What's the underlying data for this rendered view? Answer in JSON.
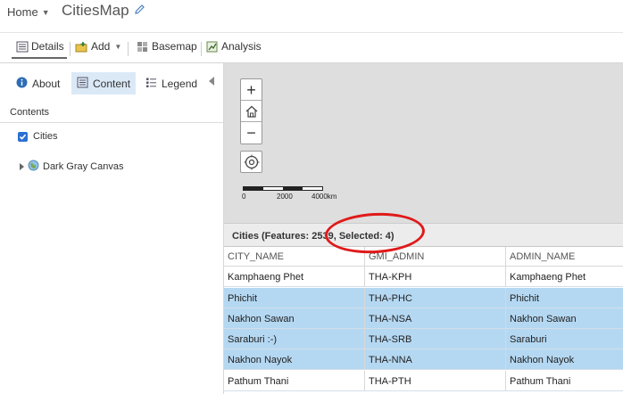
{
  "header": {
    "home_label": "Home",
    "app_title": "CitiesMap"
  },
  "toolbar": {
    "details_label": "Details",
    "add_label": "Add",
    "basemap_label": "Basemap",
    "analysis_label": "Analysis"
  },
  "panel": {
    "tabs": [
      {
        "label": "About"
      },
      {
        "label": "Content",
        "active": true
      },
      {
        "label": "Legend"
      }
    ],
    "section_title": "Contents",
    "layers": [
      {
        "label": "Cities",
        "checked": true
      }
    ],
    "basemap_layer": "Dark Gray Canvas"
  },
  "map": {
    "zoom_in": "+",
    "zoom_out": "−",
    "scale_labels": [
      "0",
      "2000",
      "4000km"
    ]
  },
  "table": {
    "caption": "Cities (Features: 2539, Selected: 4)",
    "columns": [
      "CITY_NAME",
      "GMI_ADMIN",
      "ADMIN_NAME"
    ],
    "rows": [
      {
        "city": "Kamphaeng Phet",
        "gmi": "THA-KPH",
        "admin": "Kamphaeng Phet",
        "selected": false
      },
      {
        "city": "Phichit",
        "gmi": "THA-PHC",
        "admin": "Phichit",
        "selected": true
      },
      {
        "city": "Nakhon Sawan",
        "gmi": "THA-NSA",
        "admin": "Nakhon Sawan",
        "selected": true
      },
      {
        "city": "Saraburi :-)",
        "gmi": "THA-SRB",
        "admin": "Saraburi",
        "selected": true
      },
      {
        "city": "Nakhon Nayok",
        "gmi": "THA-NNA",
        "admin": "Nakhon Nayok",
        "selected": true
      },
      {
        "city": "Pathum Thani",
        "gmi": "THA-PTH",
        "admin": "Pathum Thani",
        "selected": false
      }
    ]
  },
  "colors": {
    "selected_row": "#b5d8f2",
    "active_tab": "#dbe9f7",
    "annotation": "#e01a1a",
    "map_background": "#dedede"
  }
}
